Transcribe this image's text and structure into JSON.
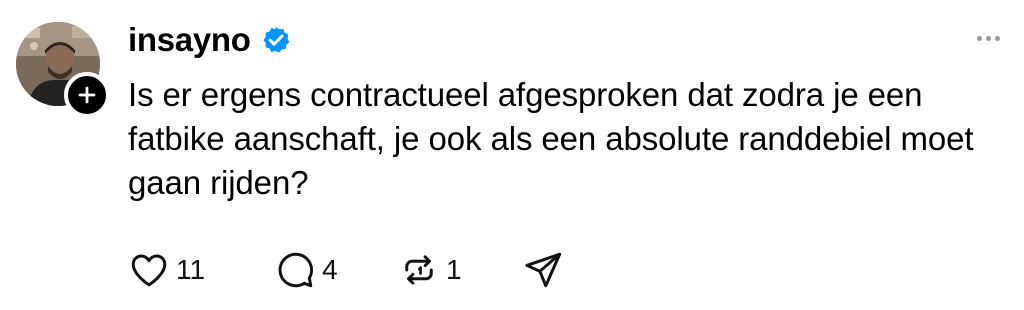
{
  "post": {
    "author": {
      "username": "insayno",
      "verified": true,
      "avatar": "avatar-photo",
      "follow_icon": "plus-icon"
    },
    "text": "Is er ergens contractueel afgesproken dat zodra je een fatbike aanschaft, je ook als een absolute randdebiel moet gaan rijden?",
    "actions": {
      "like": {
        "icon": "heart-icon",
        "count": "11"
      },
      "reply": {
        "icon": "comment-icon",
        "count": "4"
      },
      "repost": {
        "icon": "repost-icon",
        "count": "1"
      },
      "share": {
        "icon": "send-icon"
      }
    },
    "more_icon": "more-icon"
  },
  "colors": {
    "verified_badge": "#0095f6",
    "text": "#000000",
    "muted": "#9a9a9a",
    "background": "#ffffff"
  }
}
